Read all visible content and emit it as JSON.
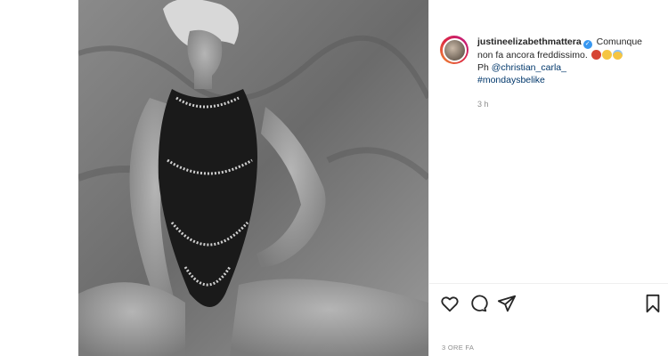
{
  "post": {
    "username": "justineelizabethmattera",
    "caption_text": "Comunque non fa ancora freddissimo.",
    "credit_prefix": "Ph",
    "credit_handle": "@christian_carla_",
    "hashtag": "#mondaysbelike",
    "relative_time": "3 h",
    "date_line": "3 ORE FA",
    "emojis": [
      "devil-emoji",
      "upside-down-face-emoji",
      "smiling-face-with-halo-emoji"
    ]
  },
  "actions": {
    "like": "heart-icon",
    "comment": "comment-icon",
    "share": "paper-plane-icon",
    "save": "bookmark-icon"
  },
  "colors": {
    "text": "#262626",
    "muted": "#8e8e8e",
    "link": "#00376b",
    "verified": "#3897f0"
  }
}
